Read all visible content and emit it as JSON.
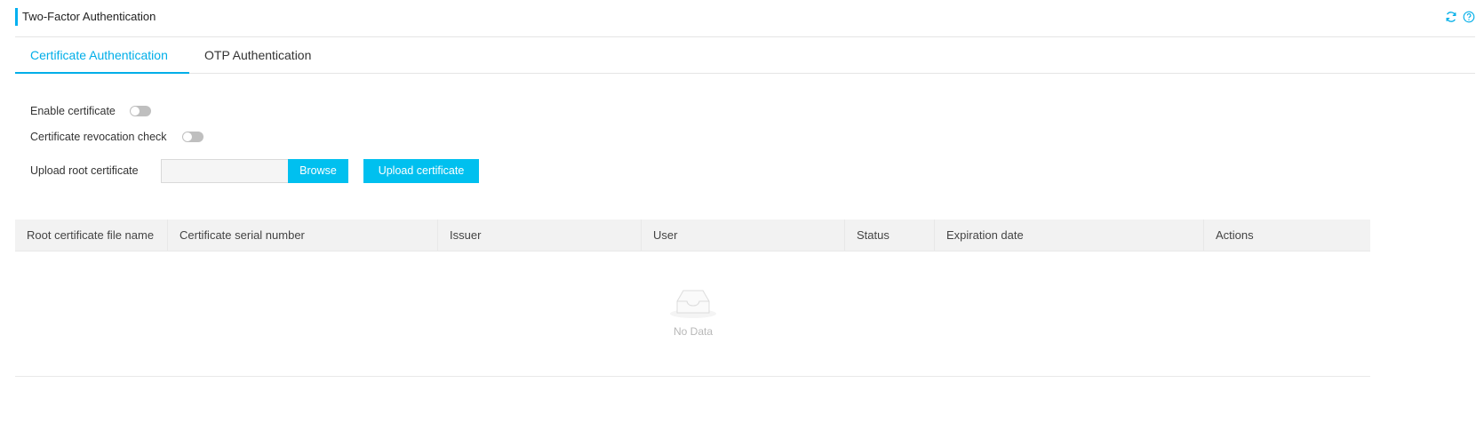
{
  "header": {
    "title": "Two-Factor Authentication",
    "icons": [
      "refresh-icon",
      "help-icon"
    ]
  },
  "tabs": [
    {
      "label": "Certificate Authentication",
      "active": true
    },
    {
      "label": "OTP Authentication",
      "active": false
    }
  ],
  "form": {
    "enable_certificate_label": "Enable certificate",
    "enable_certificate_on": false,
    "revocation_check_label": "Certificate revocation check",
    "revocation_check_on": false,
    "upload_root_label": "Upload root certificate",
    "file_value": "",
    "browse_label": "Browse",
    "upload_button_label": "Upload certificate"
  },
  "table": {
    "columns": [
      "Root certificate file name",
      "Certificate serial number",
      "Issuer",
      "User",
      "Status",
      "Expiration date",
      "Actions"
    ],
    "rows": [],
    "empty_text": "No Data"
  },
  "colors": {
    "accent": "#00aee8",
    "button": "#00c0ef",
    "toggle_off": "#bfbfbf"
  }
}
